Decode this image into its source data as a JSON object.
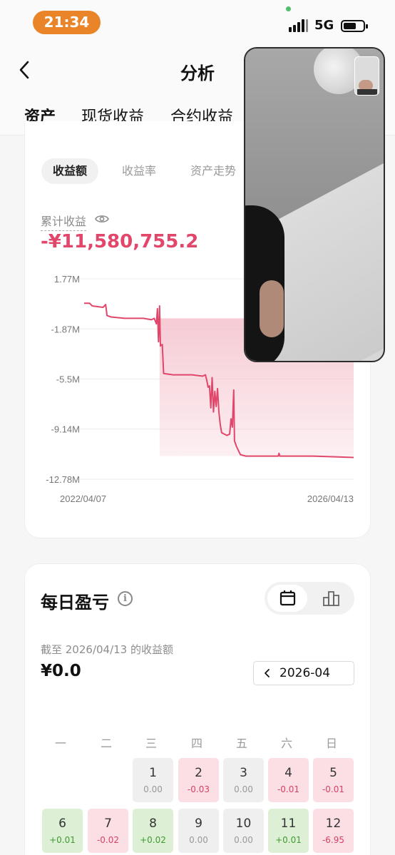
{
  "status_bar": {
    "time": "21:34",
    "network": "5G"
  },
  "header": {
    "title": "分析"
  },
  "tabs": [
    {
      "label": "资产",
      "active": true
    },
    {
      "label": "现货收益",
      "active": false
    },
    {
      "label": "合约收益",
      "active": false
    }
  ],
  "subtabs": [
    {
      "label": "收益额",
      "active": true
    },
    {
      "label": "收益率",
      "active": false
    },
    {
      "label": "资产走势",
      "active": false
    }
  ],
  "cumulative": {
    "label": "累计收益",
    "value": "-¥11,580,755.2"
  },
  "chart_data": {
    "type": "line",
    "title": "",
    "xlabel": "",
    "ylabel": "",
    "y_tick_labels": [
      "1.77M",
      "-1.87M",
      "-5.5M",
      "-9.14M",
      "-12.78M"
    ],
    "y_ticks": [
      1.77,
      -1.87,
      -5.5,
      -9.14,
      -12.78
    ],
    "ylim": [
      -12.78,
      1.77
    ],
    "x_tick_labels": [
      "2022/04/07",
      "2026/04/13"
    ],
    "xlim": [
      0,
      100
    ],
    "series": [
      {
        "color": "#e0476b",
        "points": [
          [
            0,
            0.0
          ],
          [
            2,
            0.0
          ],
          [
            3,
            -0.2
          ],
          [
            7,
            -0.3
          ],
          [
            8,
            -0.1
          ],
          [
            8.5,
            -0.9
          ],
          [
            10,
            -1.0
          ],
          [
            15,
            -1.1
          ],
          [
            22,
            -1.1
          ],
          [
            25,
            -1.2
          ],
          [
            26,
            -1.1
          ],
          [
            26.8,
            -1.5
          ],
          [
            27.2,
            -0.4
          ],
          [
            27.6,
            -2.8
          ],
          [
            28,
            -0.2
          ],
          [
            28.3,
            -3.1
          ],
          [
            29,
            -3.0
          ],
          [
            29.5,
            -5.1
          ],
          [
            33,
            -5.2
          ],
          [
            40,
            -5.2
          ],
          [
            44,
            -5.3
          ],
          [
            45,
            -5.2
          ],
          [
            45.5,
            -5.6
          ],
          [
            46,
            -6.1
          ],
          [
            46.5,
            -6.0
          ],
          [
            47,
            -7.6
          ],
          [
            47.5,
            -5.4
          ],
          [
            48,
            -7.9
          ],
          [
            48.5,
            -6.4
          ],
          [
            49,
            -7.5
          ],
          [
            49.5,
            -6.2
          ],
          [
            50,
            -7.9
          ],
          [
            50.5,
            -8.8
          ],
          [
            51,
            -9.4
          ],
          [
            52,
            -9.5
          ],
          [
            53,
            -9.6
          ],
          [
            54,
            -9.5
          ],
          [
            54.5,
            -8.4
          ],
          [
            55,
            -9.0
          ],
          [
            55.5,
            -6.3
          ],
          [
            55.8,
            -10.0
          ],
          [
            56.5,
            -10.4
          ],
          [
            58,
            -11.0
          ],
          [
            60,
            -11.1
          ],
          [
            70,
            -11.1
          ],
          [
            72,
            -11.1
          ],
          [
            72.3,
            -10.9
          ],
          [
            72.6,
            -11.1
          ],
          [
            85,
            -11.1
          ],
          [
            100,
            -11.2
          ]
        ]
      }
    ],
    "fill_color": "#f4c2cd",
    "fill_start_x": 28,
    "grid": true
  },
  "daily": {
    "title": "每日盈亏",
    "as_of": "截至 2026/04/13 的收益额",
    "value": "¥0.0",
    "month": "2026-04",
    "weekdays": [
      "一",
      "二",
      "三",
      "四",
      "五",
      "六",
      "日"
    ],
    "days": [
      {
        "day": "1",
        "value": "0.00",
        "type": "zero"
      },
      {
        "day": "2",
        "value": "-0.03",
        "type": "loss"
      },
      {
        "day": "3",
        "value": "0.00",
        "type": "zero"
      },
      {
        "day": "4",
        "value": "-0.01",
        "type": "loss"
      },
      {
        "day": "5",
        "value": "-0.01",
        "type": "loss"
      },
      {
        "day": "6",
        "value": "+0.01",
        "type": "gain"
      },
      {
        "day": "7",
        "value": "-0.02",
        "type": "loss"
      },
      {
        "day": "8",
        "value": "+0.02",
        "type": "gain"
      },
      {
        "day": "9",
        "value": "0.00",
        "type": "zero"
      },
      {
        "day": "10",
        "value": "0.00",
        "type": "zero"
      },
      {
        "day": "11",
        "value": "+0.01",
        "type": "gain"
      },
      {
        "day": "12",
        "value": "-6.95",
        "type": "loss"
      }
    ],
    "first_weekday_index": 2
  },
  "colors": {
    "loss": "#e0476b",
    "accent": "#e98528",
    "gain": "#3f9a2f"
  }
}
